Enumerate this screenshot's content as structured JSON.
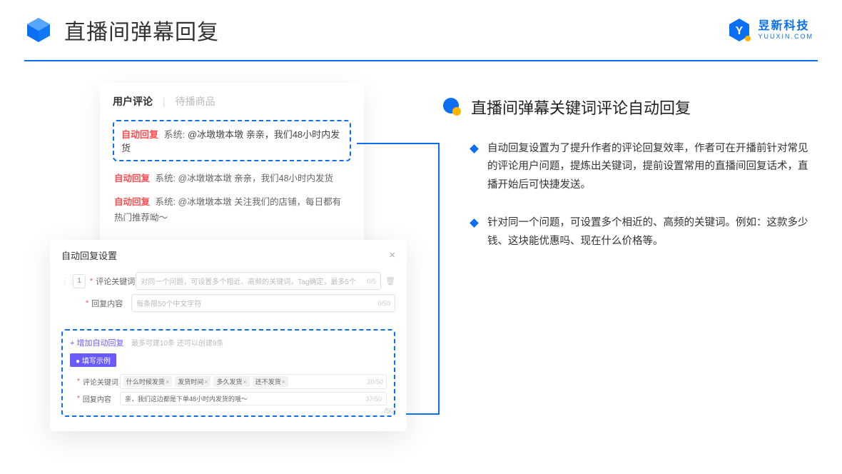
{
  "header": {
    "title": "直播间弹幕回复"
  },
  "brand": {
    "name": "昱新科技",
    "domain": "YUUXIN.COM"
  },
  "comments": {
    "tab_active": "用户评论",
    "tab_sep": "|",
    "tab_inactive": "待播商品",
    "highlighted": {
      "tag": "自动回复",
      "system": "系统:",
      "text": "@冰墩墩本墩 亲亲，我们48小时内发货"
    },
    "rows": [
      {
        "tag": "自动回复",
        "system": "系统:",
        "text": "@冰墩墩本墩 亲亲，我们48小时内发货"
      },
      {
        "tag": "自动回复",
        "system": "系统:",
        "text": "@冰墩墩本墩 关注我们的店铺，每日都有热门推荐呦～"
      }
    ]
  },
  "modal": {
    "title": "自动回复设置",
    "close": "×",
    "index": "1",
    "keyword_label": "评论关键词",
    "keyword_ph": "对同一个问题，可设置多个相近、高频的关键词，Tag确定，最多5个",
    "keyword_cnt": "0/5",
    "content_label": "回复内容",
    "content_ph": "每条限50个中文字符",
    "content_cnt": "0/50",
    "add_link": "+ 增加自动回复",
    "add_hint": "最多可建10条 还可以创建9条",
    "example_pill": "● 填写示例",
    "ex_kw_label": "评论关键词",
    "chips": [
      "什么时候发货",
      "发货时间",
      "多久发货",
      "还不发货"
    ],
    "ex_kw_cnt": "20/50",
    "ex_content_label": "回复内容",
    "ex_content_val": "亲，我们这边都是下单48小时内发货的哦～",
    "ex_content_cnt": "37/50",
    "side_cnt": "/50"
  },
  "section": {
    "title": "直播间弹幕关键词评论自动回复",
    "bullets": [
      "自动回复设置为了提升作者的评论回复效率，作者可在开播前针对常见的评论用户问题，提炼出关键词，提前设置常用的直播间回复话术，直播开始后可快捷发送。",
      "针对同一个问题，可设置多个相近的、高频的关键词。例如：这款多少钱、这块能优惠吗、现在什么价格等。"
    ]
  }
}
